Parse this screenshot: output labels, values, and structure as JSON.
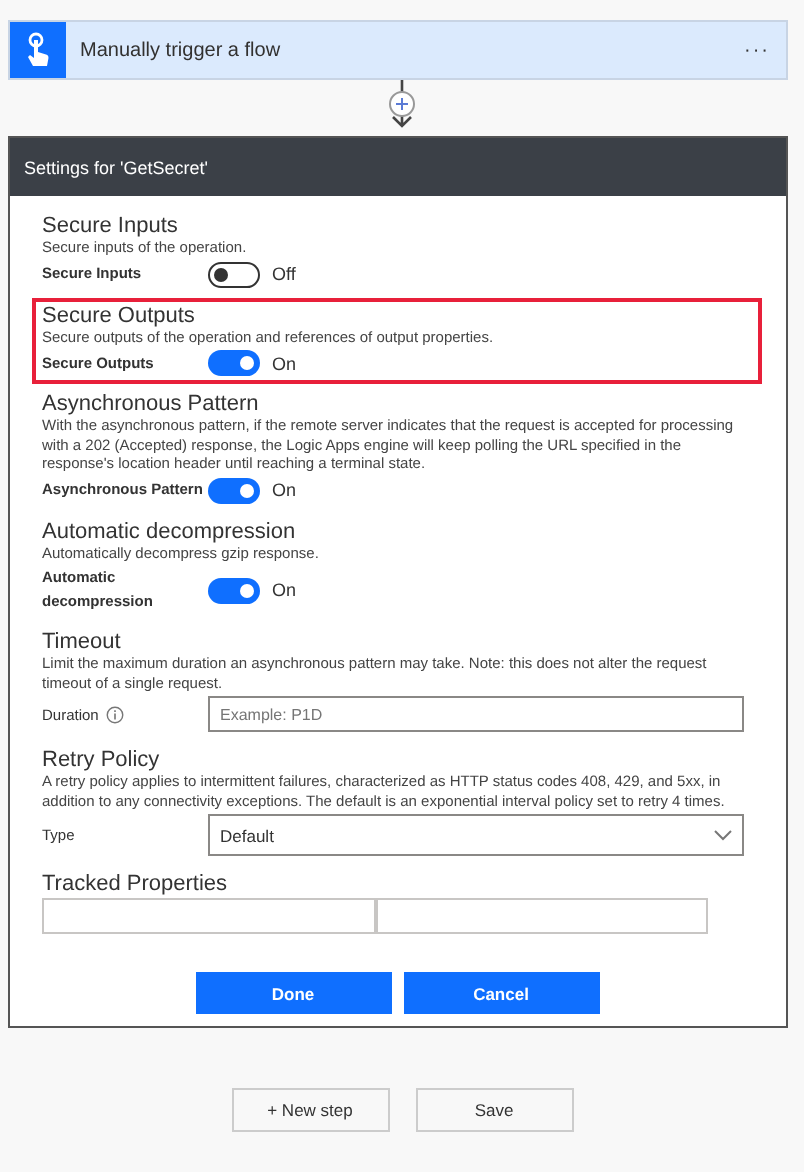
{
  "trigger": {
    "title": "Manually trigger a flow",
    "menu": "···"
  },
  "settings": {
    "title": "Settings for 'GetSecret'",
    "sections": [
      {
        "kind": "toggle",
        "title": "Secure Inputs",
        "description": "Secure inputs of the operation.",
        "label": "Secure Inputs",
        "on": false,
        "state_text": "Off",
        "highlighted": false
      },
      {
        "kind": "toggle",
        "title": "Secure Outputs",
        "description": "Secure outputs of the operation and references of output properties.",
        "label": "Secure Outputs",
        "on": true,
        "state_text": "On",
        "highlighted": true
      },
      {
        "kind": "toggle",
        "title": "Asynchronous Pattern",
        "description": "With the asynchronous pattern, if the remote server indicates that the request is accepted for processing with a 202 (Accepted) response, the Logic Apps engine will keep polling the URL specified in the response's location header until reaching a terminal state.",
        "label": "Asynchronous Pattern",
        "on": true,
        "state_text": "On",
        "highlighted": false
      },
      {
        "kind": "toggle",
        "title": "Automatic decompression",
        "description": "Automatically decompress gzip response.",
        "label": "Automatic decompression",
        "on": true,
        "state_text": "On",
        "highlighted": false
      },
      {
        "kind": "field",
        "title": "Timeout",
        "description": "Limit the maximum duration an asynchronous pattern may take. Note: this does not alter the request timeout of a single request.",
        "label": "Duration",
        "placeholder": "Example: P1D",
        "highlighted": false
      },
      {
        "kind": "select",
        "title": "Retry Policy",
        "description": "A retry policy applies to intermittent failures, characterized as HTTP status codes 408, 429, and 5xx, in addition to any connectivity exceptions. The default is an exponential interval policy set to retry 4 times.",
        "label": "Type",
        "value": "Default",
        "highlighted": false
      },
      {
        "kind": "pair",
        "title": "Tracked Properties",
        "highlighted": false
      }
    ],
    "buttons": [
      "Done",
      "Cancel"
    ]
  },
  "footer_buttons": [
    "+ New step",
    "Save"
  ]
}
